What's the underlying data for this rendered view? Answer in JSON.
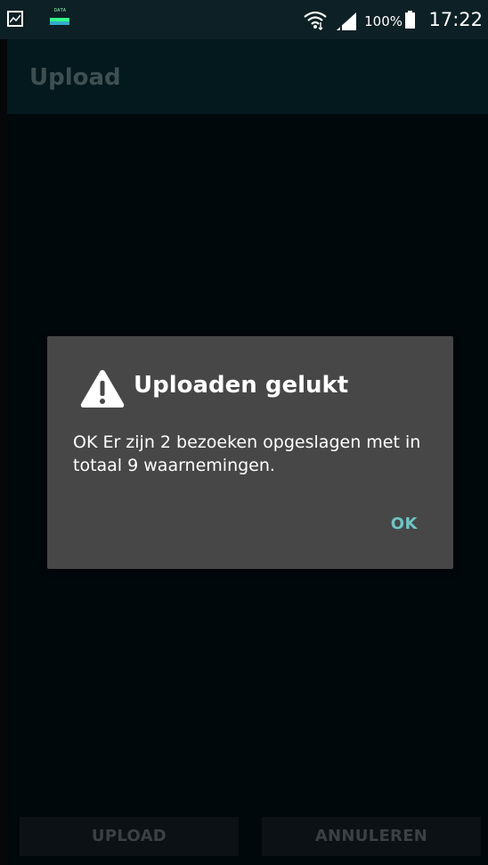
{
  "status_bar": {
    "data_label": "DATA",
    "battery_percent": "100%",
    "time": "17:22",
    "icons": [
      "gallery-icon",
      "data-icon",
      "wifi-icon",
      "signal-icon",
      "battery-icon"
    ]
  },
  "app_bar": {
    "title": "Upload"
  },
  "bottom_buttons": {
    "upload_label": "UPLOAD",
    "cancel_label": "ANNULEREN"
  },
  "dialog": {
    "icon": "warning-icon",
    "title": "Uploaden gelukt",
    "message": "OK Er zijn 2 bezoeken opgeslagen met in totaal 9 waarnemingen.",
    "ok_label": "OK"
  },
  "colors": {
    "status_bar_bg": "#0d2025",
    "app_bar_bg": "#04191d",
    "dialog_bg": "#474747",
    "accent": "#6fc4c4"
  }
}
